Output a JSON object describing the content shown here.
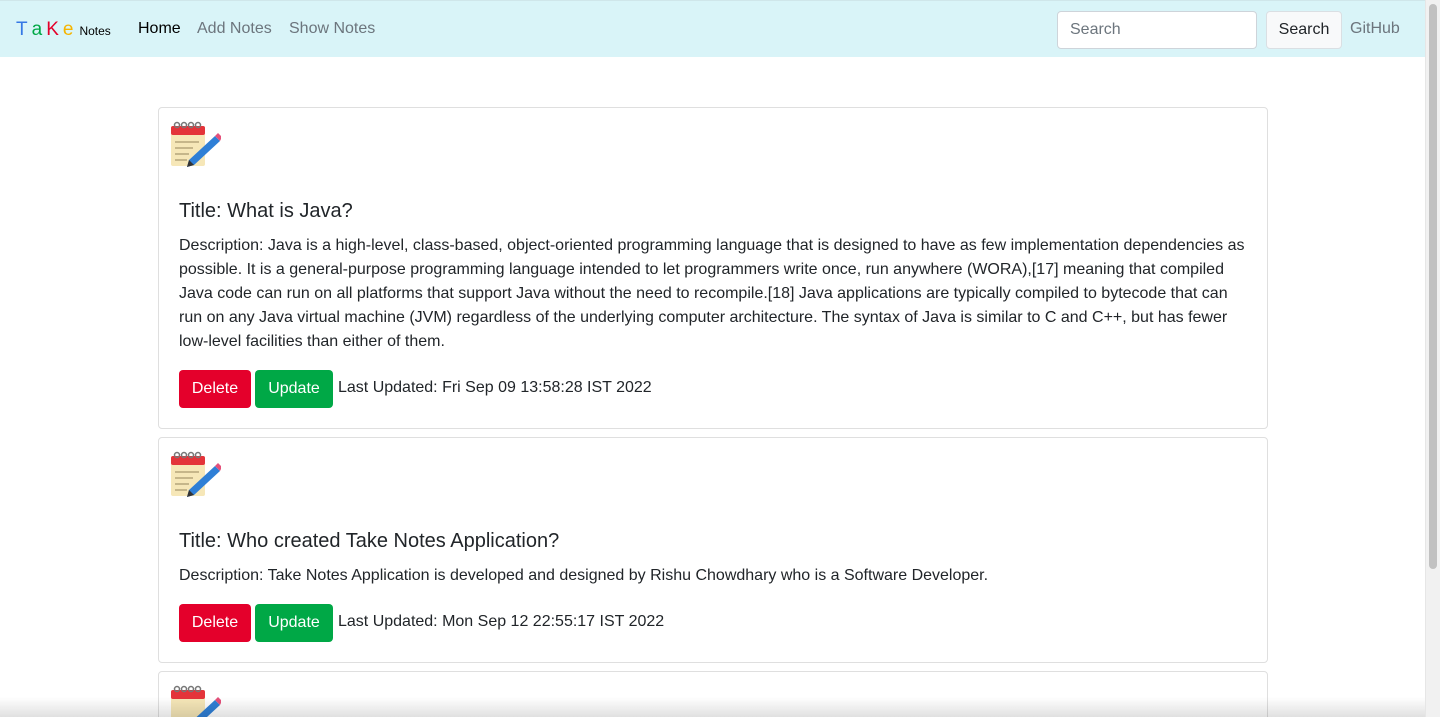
{
  "navbar": {
    "brand_letters": [
      "T",
      "a",
      "K",
      "e"
    ],
    "brand_colors": [
      "#3578e5",
      "#00a846",
      "#e4002b",
      "#f5b400"
    ],
    "brand_suffix": "Notes",
    "links": [
      "Home",
      "Add Notes",
      "Show Notes"
    ],
    "search_placeholder": "Search",
    "search_button": "Search",
    "github": "GitHub"
  },
  "notes": [
    {
      "icon": "note-pencil-icon",
      "title": "Title: What is Java?",
      "description": "Description: Java is a high-level, class-based, object-oriented programming language that is designed to have as few implementation dependencies as possible. It is a general-purpose programming language intended to let programmers write once, run anywhere (WORA),[17] meaning that compiled Java code can run on all platforms that support Java without the need to recompile.[18] Java applications are typically compiled to bytecode that can run on any Java virtual machine (JVM) regardless of the underlying computer architecture. The syntax of Java is similar to C and C++, but has fewer low-level facilities than either of them.",
      "delete_label": "Delete",
      "update_label": "Update",
      "last_updated": "Last Updated: Fri Sep 09 13:58:28 IST 2022"
    },
    {
      "icon": "note-pencil-icon",
      "title": "Title: Who created Take Notes Application?",
      "description": "Description: Take Notes Application is developed and designed by Rishu Chowdhary who is a Software Developer.",
      "delete_label": "Delete",
      "update_label": "Update",
      "last_updated": "Last Updated: Mon Sep 12 22:55:17 IST 2022"
    },
    {
      "icon": "note-pencil-icon"
    }
  ]
}
